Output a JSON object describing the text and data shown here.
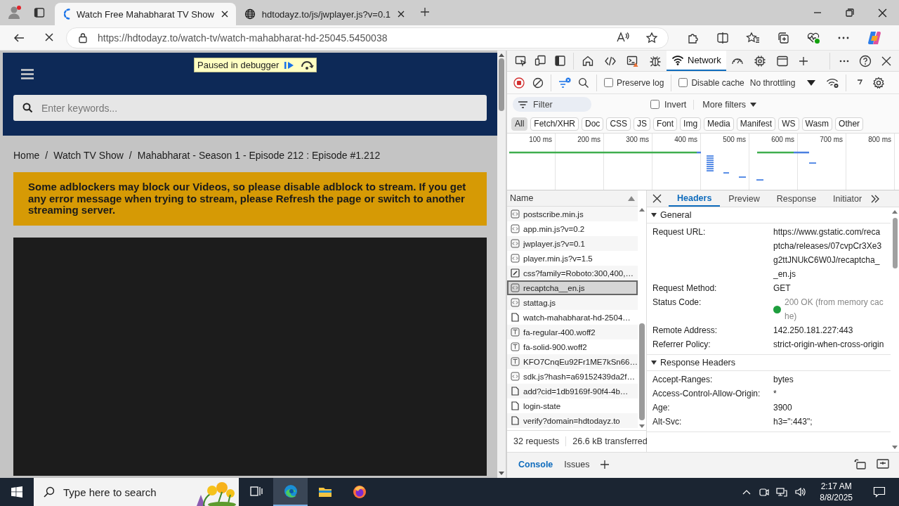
{
  "browser": {
    "tabs": [
      {
        "title": "Watch Free Mahabharat TV Show",
        "kind": "loading",
        "selected": true
      },
      {
        "title": "hdtodayz.to/js/jwplayer.js?v=0.1",
        "kind": "globe",
        "selected": false
      }
    ],
    "url": "https://hdtodayz.to/watch-tv/watch-mahabharat-hd-25045.5450038"
  },
  "page": {
    "debugger_badge": "Paused in debugger",
    "search": {
      "placeholder": "Enter keywords..."
    },
    "breadcrumb": [
      "Home",
      "Watch TV Show",
      "Mahabharat - Season 1 - Episode 212 : Episode #1.212"
    ],
    "breadcrumb_separator": "/",
    "notice": "Some adblockers may block our Videos, so please disable adblock to stream. If you get any error message when trying to stream, please Refresh the page or switch to another streaming server."
  },
  "devtools": {
    "panel_tabs": [
      {
        "kind": "welcome",
        "selected": false
      },
      {
        "kind": "elements",
        "selected": false
      },
      {
        "kind": "console",
        "selected": false
      },
      {
        "kind": "sources",
        "selected": false
      },
      {
        "kind": "network",
        "label": "Network",
        "selected": true
      },
      {
        "kind": "performance",
        "selected": false
      },
      {
        "kind": "memory",
        "selected": false
      },
      {
        "kind": "application",
        "selected": false
      }
    ],
    "recording": true,
    "checkboxes": [
      {
        "label": "Preserve log",
        "checked": false
      },
      {
        "label": "Disable cache",
        "checked": false
      }
    ],
    "throttling": "No throttling",
    "filter": {
      "placeholder": "Filter"
    },
    "invert": {
      "label": "Invert",
      "checked": false
    },
    "more_filters": "More filters",
    "type_filters": [
      {
        "label": "All",
        "selected": true
      },
      {
        "label": "Fetch/XHR",
        "selected": false
      },
      {
        "label": "Doc",
        "selected": false
      },
      {
        "label": "CSS",
        "selected": false
      },
      {
        "label": "JS",
        "selected": false
      },
      {
        "label": "Font",
        "selected": false
      },
      {
        "label": "Img",
        "selected": false
      },
      {
        "label": "Media",
        "selected": false
      },
      {
        "label": "Manifest",
        "selected": false
      },
      {
        "label": "WS",
        "selected": false
      },
      {
        "label": "Wasm",
        "selected": false
      },
      {
        "label": "Other",
        "selected": false
      }
    ],
    "timeline_ticks": [
      "100 ms",
      "200 ms",
      "300 ms",
      "400 ms",
      "500 ms",
      "600 ms",
      "700 ms",
      "800 ms"
    ],
    "requests": {
      "column": "Name",
      "rows": [
        {
          "name": "postscribe.min.js",
          "kind": "script",
          "selected": false
        },
        {
          "name": "app.min.js?v=0.2",
          "kind": "script",
          "selected": false
        },
        {
          "name": "jwplayer.js?v=0.1",
          "kind": "script",
          "selected": false
        },
        {
          "name": "player.min.js?v=1.5",
          "kind": "script",
          "selected": false
        },
        {
          "name": "css?family=Roboto:300,400,…",
          "kind": "stylesheet",
          "selected": false
        },
        {
          "name": "recaptcha__en.js",
          "kind": "script",
          "selected": true
        },
        {
          "name": "stattag.js",
          "kind": "script",
          "selected": false
        },
        {
          "name": "watch-mahabharat-hd-2504…",
          "kind": "document",
          "selected": false
        },
        {
          "name": "fa-regular-400.woff2",
          "kind": "font",
          "selected": false
        },
        {
          "name": "fa-solid-900.woff2",
          "kind": "font",
          "selected": false
        },
        {
          "name": "KFO7CnqEu92Fr1ME7kSn66…",
          "kind": "font",
          "selected": false
        },
        {
          "name": "sdk.js?hash=a69152439da2f…",
          "kind": "script",
          "selected": false
        },
        {
          "name": "add?cid=1db9169f-90f4-4b…",
          "kind": "document",
          "selected": false
        },
        {
          "name": "login-state",
          "kind": "document",
          "selected": false
        },
        {
          "name": "verify?domain=hdtodayz.to",
          "kind": "document",
          "selected": false
        }
      ],
      "summary": [
        "32 requests",
        "26.6 kB transferred"
      ]
    },
    "details": {
      "tabs": [
        {
          "label": "Headers",
          "selected": true
        },
        {
          "label": "Preview",
          "selected": false
        },
        {
          "label": "Response",
          "selected": false
        },
        {
          "label": "Initiator",
          "selected": false
        }
      ],
      "sections": [
        {
          "title": "General",
          "expanded": true,
          "rows": [
            {
              "key": "Request URL:",
              "value": "https://www.gstatic.com/recaptcha/releases/07cvpCr3Xe3g2ttJNUkC6W0J/recaptcha__en.js"
            },
            {
              "key": "Request Method:",
              "value": "GET"
            },
            {
              "key": "Status Code:",
              "value": "200 OK (from memory cache)",
              "color": "#1e9e3e"
            },
            {
              "key": "Remote Address:",
              "value": "142.250.181.227:443"
            },
            {
              "key": "Referrer Policy:",
              "value": "strict-origin-when-cross-origin"
            }
          ]
        },
        {
          "title": "Response Headers",
          "expanded": true,
          "rows": [
            {
              "key": "Accept-Ranges:",
              "value": "bytes"
            },
            {
              "key": "Access-Control-Allow-Origin:",
              "value": "*"
            },
            {
              "key": "Age:",
              "value": "3900"
            },
            {
              "key": "Alt-Svc:",
              "value": "h3=\":443\";"
            }
          ]
        }
      ]
    },
    "drawer_tabs": [
      {
        "label": "Console",
        "selected": true
      },
      {
        "label": "Issues",
        "selected": false
      }
    ]
  },
  "taskbar": {
    "search_placeholder": "Type here to search",
    "apps": [
      {
        "kind": "task-view",
        "selected": false
      },
      {
        "kind": "edge",
        "selected": true
      },
      {
        "kind": "explorer",
        "selected": false
      },
      {
        "kind": "firefox",
        "selected": false
      }
    ],
    "time": "2:17 AM",
    "date": "8/8/2025"
  }
}
